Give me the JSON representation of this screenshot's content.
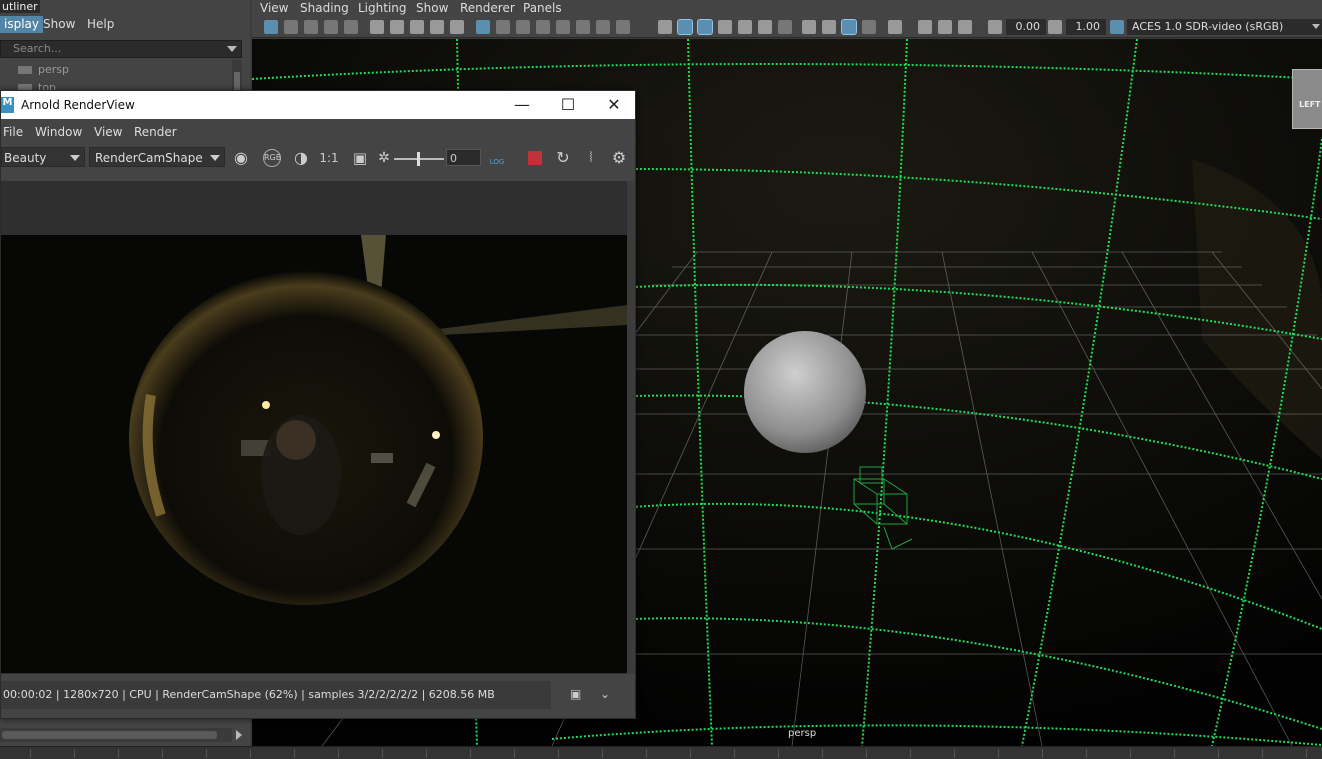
{
  "outliner": {
    "title": "utliner",
    "menus": [
      "isplay",
      "Show",
      "Help"
    ],
    "search_placeholder": "Search...",
    "items": [
      "persp",
      "top"
    ]
  },
  "viewport": {
    "menus": [
      "View",
      "Shading",
      "Lighting",
      "Show",
      "Renderer",
      "Panels"
    ],
    "exposure": "0.00",
    "gamma": "1.00",
    "color_space": "ACES 1.0 SDR-video (sRGB)",
    "camera_label": "persp",
    "viewcube_label": "LEFT",
    "grid_color": "#22dd55"
  },
  "arnold": {
    "title": "Arnold RenderView",
    "logo": "M",
    "window_buttons": {
      "minimize": "—",
      "maximize": "☐",
      "close": "✕"
    },
    "menus": [
      "File",
      "Window",
      "View",
      "Render"
    ],
    "aov": "Beauty",
    "camera": "RenderCamShape",
    "rgb_label": "RGB",
    "ratio_label": "1:1",
    "exposure_value": "0",
    "log_label": "LOG",
    "status_text": "00:00:02 | 1280x720 | CPU | RenderCamShape (62%) | samples 3/2/2/2/2/2 | 6208.56 MB"
  }
}
